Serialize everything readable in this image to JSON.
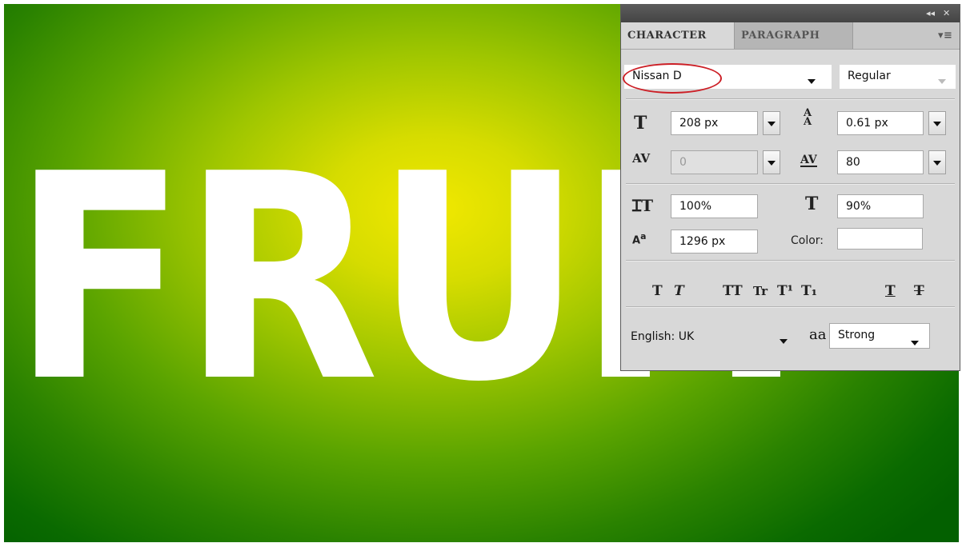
{
  "canvas": {
    "text": "FRUIT"
  },
  "panel": {
    "tabs": [
      "CHARACTER",
      "PARAGRAPH"
    ],
    "font_family": "Nissan D",
    "font_style": "Regular",
    "font_size": "208 px",
    "leading": "0.61 px",
    "kerning": "0",
    "tracking": "80",
    "vertical_scale": "100%",
    "horizontal_scale": "90%",
    "baseline_shift": "1296 px",
    "color_label": "Color:",
    "color_value": "#ffffff",
    "language": "English: UK",
    "antialias": "Strong",
    "antialias_icon_text": "aa",
    "format_buttons": [
      "T",
      "T",
      "TT",
      "Tr",
      "T¹",
      "T₁",
      "T",
      "T"
    ]
  },
  "colors": {
    "highlight": "#cc1f26",
    "gradient_center": "#f1e800",
    "gradient_edge": "#036000"
  }
}
